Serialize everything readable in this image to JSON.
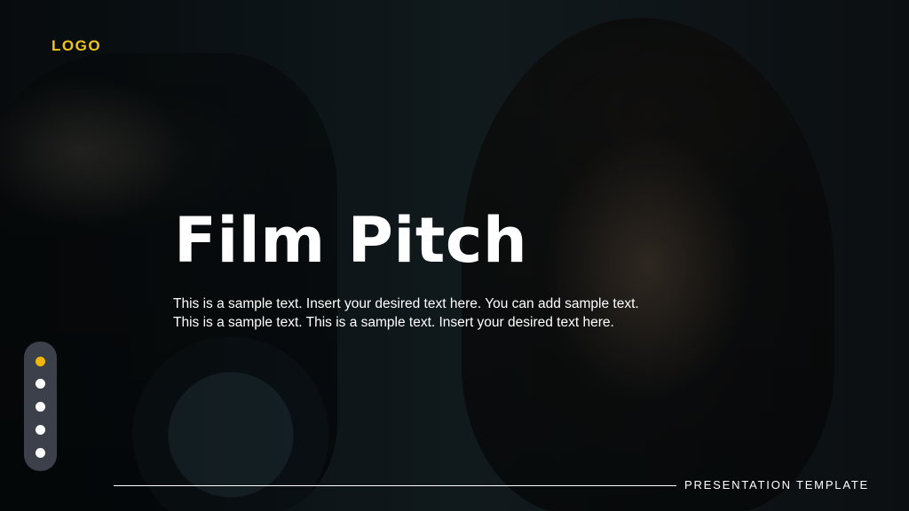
{
  "brand": {
    "logo_text": "LOGO"
  },
  "slide": {
    "title": "Film Pitch",
    "body_lines": [
      "This is a sample text. Insert your desired text here. You can add sample text.",
      "This is a sample text. This is a sample text. Insert your desired text here."
    ],
    "footer_text": "PRESENTATION TEMPLATE"
  },
  "pager": {
    "count": 5,
    "active_index": 0
  },
  "colors": {
    "accent": "#f2c318",
    "dot_active": "#f2b50b",
    "pager_background": "#464a56",
    "text": "#ffffff"
  },
  "background": {
    "description_icon": "photo-background"
  }
}
